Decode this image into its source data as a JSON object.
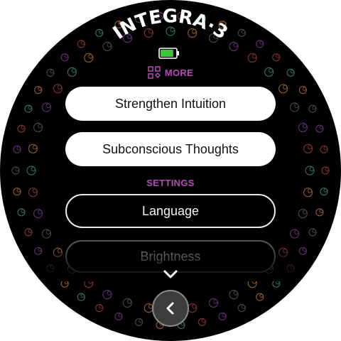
{
  "device": {
    "brand_title": "INTEGRA·3",
    "battery": {
      "level": 0.85,
      "color": "#3dc43d"
    }
  },
  "more": {
    "label": "MORE",
    "icon": "grid-diamond-icon",
    "color": "#b64bb6"
  },
  "menu": {
    "items": [
      {
        "label": "Strengthen Intuition"
      },
      {
        "label": "Subconscious Thoughts"
      }
    ]
  },
  "settings": {
    "section_label": "SETTINGS",
    "items": [
      {
        "label": "Language"
      },
      {
        "label": "Brightness"
      }
    ]
  },
  "navigation": {
    "scroll_icon": "chevron-down-icon",
    "back_icon": "chevron-left-icon"
  }
}
